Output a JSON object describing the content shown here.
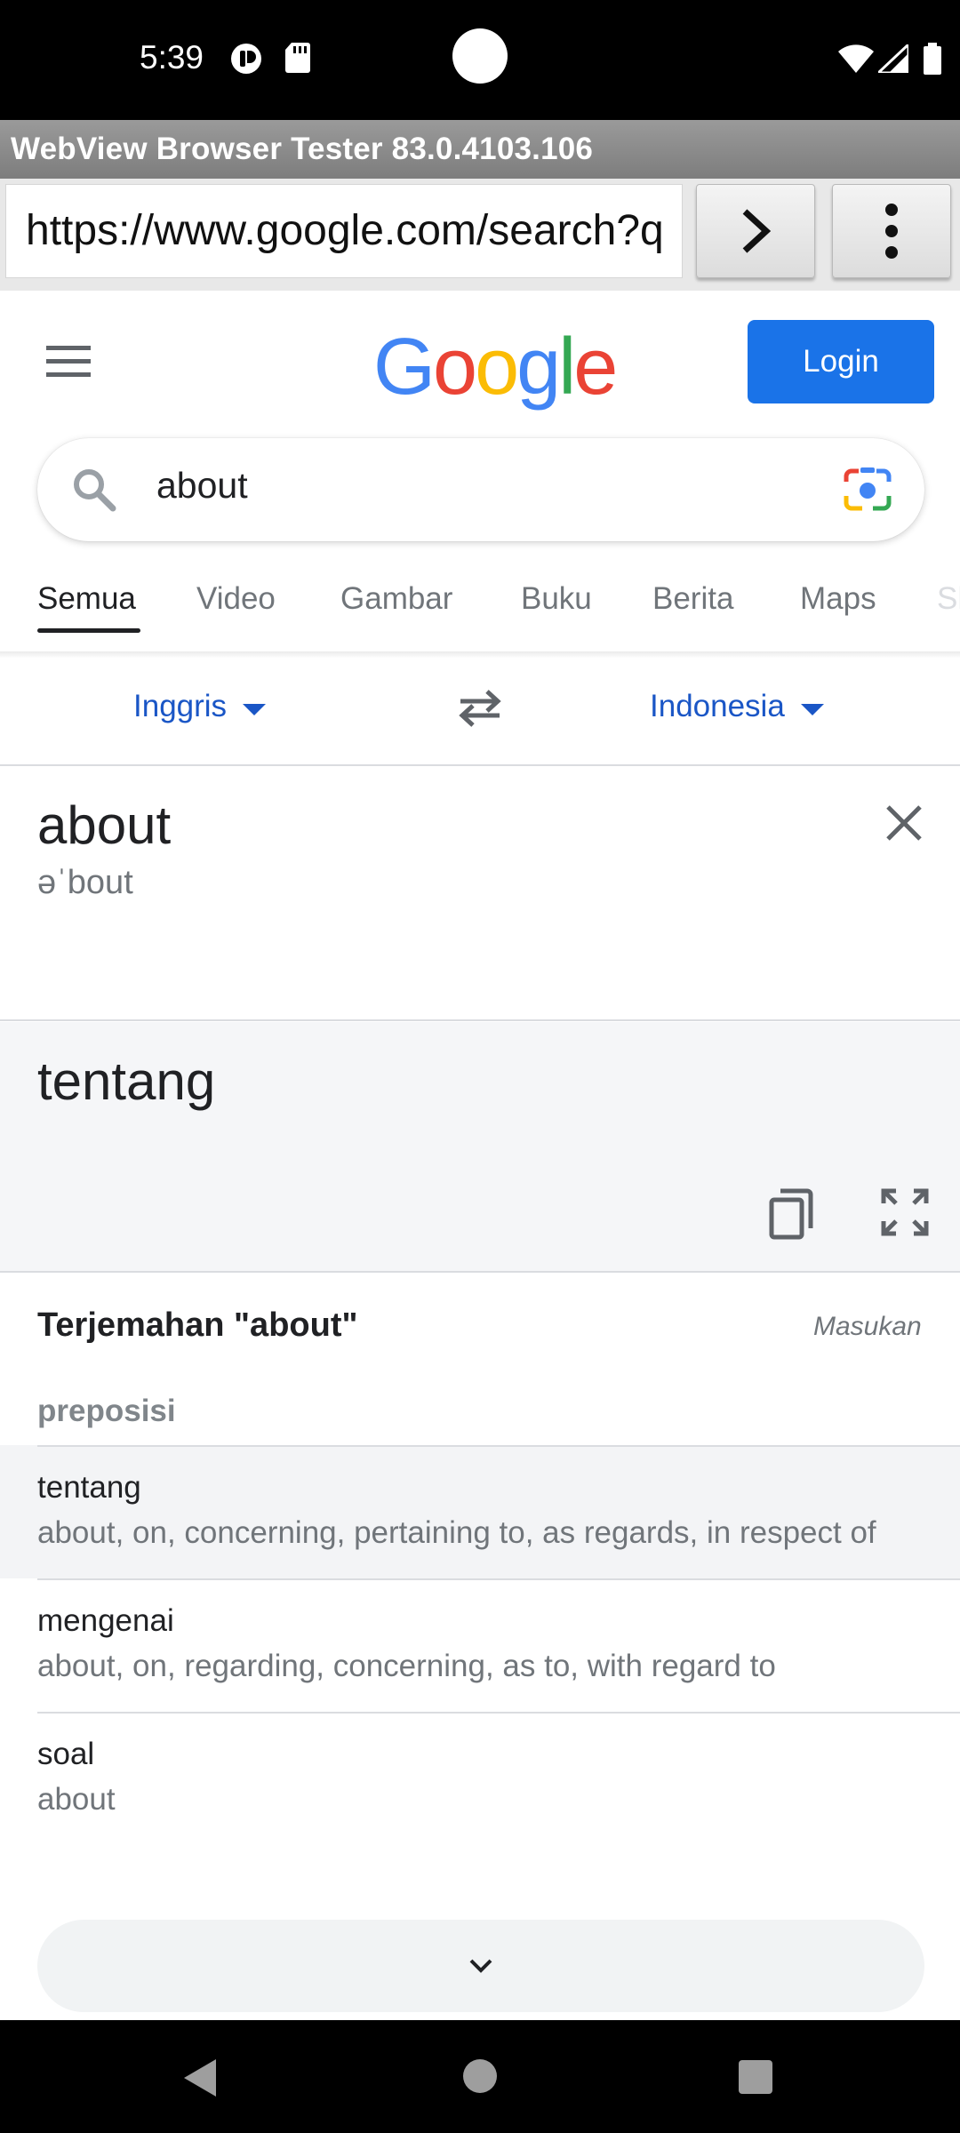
{
  "status_bar": {
    "time": "5:39"
  },
  "app": {
    "title": "WebView Browser Tester 83.0.4103.106"
  },
  "url_bar": {
    "url": "https://www.google.com/search?q"
  },
  "header": {
    "logo_letters": [
      {
        "ch": "G",
        "color": "#4285F4"
      },
      {
        "ch": "o",
        "color": "#EA4335"
      },
      {
        "ch": "o",
        "color": "#FBBC05"
      },
      {
        "ch": "g",
        "color": "#4285F4"
      },
      {
        "ch": "l",
        "color": "#34A853"
      },
      {
        "ch": "e",
        "color": "#EA4335"
      }
    ],
    "login_label": "Login"
  },
  "search": {
    "query": "about"
  },
  "tabs": [
    "Semua",
    "Video",
    "Gambar",
    "Buku",
    "Berita",
    "Maps",
    "Sh"
  ],
  "translate": {
    "source_lang": "Inggris",
    "target_lang": "Indonesia",
    "source_text": "about",
    "phonetic": "əˈbout",
    "target_text": "tentang"
  },
  "dictionary": {
    "title": "Terjemahan \"about\"",
    "feedback": "Masukan",
    "part_of_speech": "preposisi",
    "entries": [
      {
        "word": "tentang",
        "synonyms": "about, on, concerning, pertaining to, as regards, in respect of"
      },
      {
        "word": "mengenai",
        "synonyms": "about, on, regarding, concerning, as to, with regard to"
      },
      {
        "word": "soal",
        "synonyms": "about"
      }
    ]
  },
  "colors": {
    "accent_blue": "#1a73e8",
    "link_blue": "#1a56c6"
  }
}
